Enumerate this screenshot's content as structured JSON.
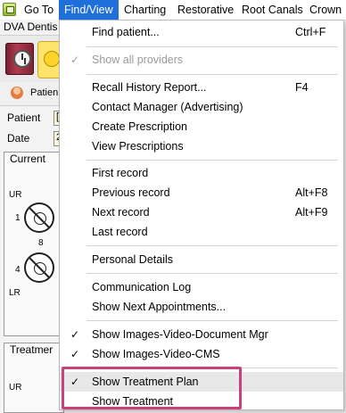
{
  "menubar": {
    "items": [
      {
        "label": "Go To"
      },
      {
        "label": "Find/View"
      },
      {
        "label": "Charting"
      },
      {
        "label": "Restorative"
      },
      {
        "label": "Root Canals"
      },
      {
        "label": "Crown"
      }
    ]
  },
  "app": {
    "title_partial": "DVA Dentis",
    "patient_tab": "Patien",
    "field_patient": "Patient",
    "field_date": "Date",
    "field_patient_val": "[",
    "field_date_val": "2",
    "panel_current": "Current",
    "panel_treatment": "Treatmer",
    "label_ur": "UR",
    "label_lr": "LR",
    "label_1": "1",
    "label_8": "8",
    "label_4": "4"
  },
  "dropdown": {
    "items": [
      {
        "label": "Find patient...",
        "shortcut": "Ctrl+F"
      },
      {
        "label": "Show all providers",
        "shortcut": "",
        "checked": true,
        "disabled": true
      },
      {
        "label": "Recall History Report...",
        "shortcut": "F4"
      },
      {
        "label": "Contact Manager (Advertising)",
        "shortcut": ""
      },
      {
        "label": "Create Prescription",
        "shortcut": ""
      },
      {
        "label": "View Prescriptions",
        "shortcut": ""
      },
      {
        "label": "First record",
        "shortcut": ""
      },
      {
        "label": "Previous record",
        "shortcut": "Alt+F8"
      },
      {
        "label": "Next record",
        "shortcut": "Alt+F9"
      },
      {
        "label": "Last record",
        "shortcut": ""
      },
      {
        "label": "Personal Details",
        "shortcut": ""
      },
      {
        "label": "Communication Log",
        "shortcut": ""
      },
      {
        "label": "Show Next Appointments...",
        "shortcut": ""
      },
      {
        "label": "Show Images-Video-Document Mgr",
        "shortcut": "",
        "checked": true
      },
      {
        "label": "Show Images-Video-CMS",
        "shortcut": "",
        "checked": true
      },
      {
        "label": "Show Treatment Plan",
        "shortcut": "",
        "checked": true,
        "hovered": true
      },
      {
        "label": "Show Treatment",
        "shortcut": ""
      }
    ],
    "check_glyph": "✓"
  },
  "colors": {
    "menubar_active": "#1e6fd9",
    "highlight_border": "#c9407a"
  }
}
